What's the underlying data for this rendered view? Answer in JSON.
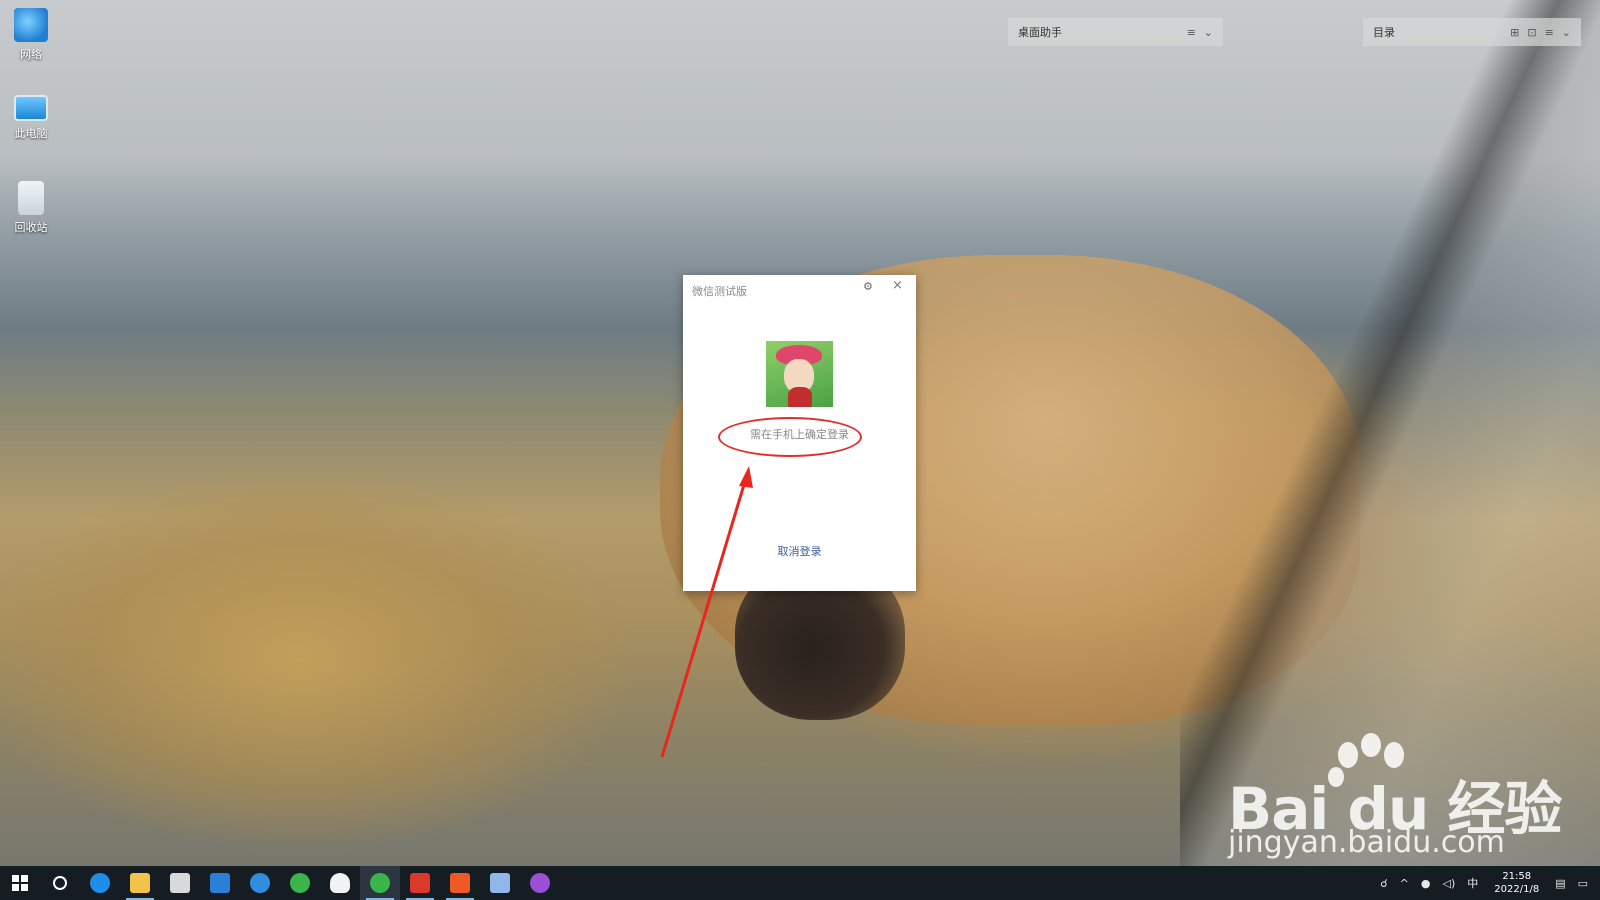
{
  "desktop_icons": [
    {
      "label": "网络",
      "icon": "network-icon"
    },
    {
      "label": "此电脑",
      "icon": "computer-icon"
    },
    {
      "label": "回收站",
      "icon": "recycle-bin-icon"
    }
  ],
  "top_bars": [
    {
      "title": "桌面助手",
      "controls": [
        "menu-icon",
        "chevron-down-icon"
      ]
    },
    {
      "title": "目录",
      "controls": [
        "grid-icon",
        "lock-icon",
        "menu-icon",
        "chevron-down-icon"
      ]
    }
  ],
  "dialog": {
    "title": "微信测试版",
    "gear_glyph": "⚙",
    "close_glyph": "×",
    "message": "需在手机上确定登录",
    "cancel_label": "取消登录"
  },
  "watermark": {
    "logo_text": "Bai du 经验",
    "url": "jingyan.baidu.com"
  },
  "taskbar": {
    "apps": [
      {
        "name": "start-button",
        "icon": "windows-icon",
        "color": "#ffffff"
      },
      {
        "name": "cortana-button",
        "icon": "search-circle-icon",
        "color": "#ffffff"
      },
      {
        "name": "edge-button",
        "icon": "edge-icon",
        "color": "#1f8ee8"
      },
      {
        "name": "file-explorer-button",
        "icon": "folder-icon",
        "color": "#f3c24a"
      },
      {
        "name": "store-button",
        "icon": "store-icon",
        "color": "#d9d9d9"
      },
      {
        "name": "mail-button",
        "icon": "mail-icon",
        "color": "#2a7fd6"
      },
      {
        "name": "ie-button",
        "icon": "ie-icon",
        "color": "#2f8ee0"
      },
      {
        "name": "qq-browser-button",
        "icon": "browser-icon",
        "color": "#3bb54a"
      },
      {
        "name": "qq-button",
        "icon": "qq-penguin-icon",
        "color": "#f2f2f2"
      },
      {
        "name": "wechat-button",
        "icon": "wechat-icon",
        "color": "#3ab54a"
      },
      {
        "name": "wps-button",
        "icon": "wps-icon",
        "color": "#d93a2b"
      },
      {
        "name": "brave-button",
        "icon": "brave-icon",
        "color": "#ef5a24"
      },
      {
        "name": "app-button",
        "icon": "window-app-icon",
        "color": "#8fb8e8"
      },
      {
        "name": "app-purple-button",
        "icon": "purple-app-icon",
        "color": "#9b4fd6"
      }
    ],
    "tray": {
      "ime_label": "中",
      "time": "21:58",
      "date": "2022/1/8"
    }
  }
}
